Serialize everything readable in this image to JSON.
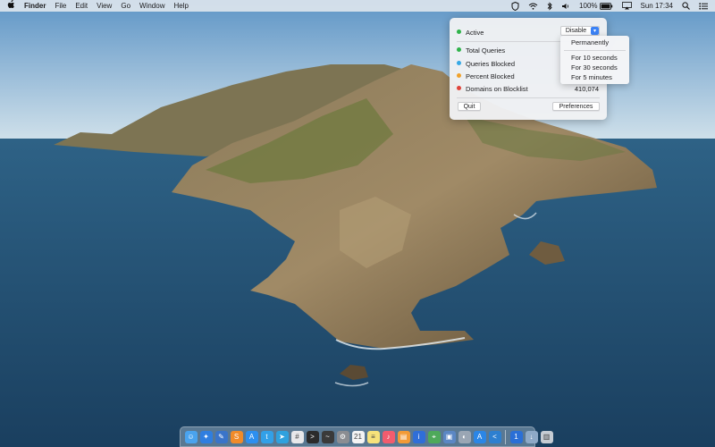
{
  "menubar": {
    "apple_icon": "apple-logo-icon",
    "app_name": "Finder",
    "menus": [
      "File",
      "Edit",
      "View",
      "Go",
      "Window",
      "Help"
    ],
    "status_icons": [
      "pihole-shield-icon",
      "wifi-icon",
      "bluetooth-icon",
      "volume-icon"
    ],
    "battery": "100%",
    "airplay_icon": "airplay-icon",
    "clock": "Sun 17:34",
    "search_icon": "spotlight-search-icon",
    "control_icon": "notification-center-icon"
  },
  "panel": {
    "status_label": "Active",
    "status_color": "#2fb34a",
    "disable_label": "Disable",
    "stats": [
      {
        "label": "Total Queries",
        "value": "",
        "color": "#2fb34a"
      },
      {
        "label": "Queries Blocked",
        "value": "",
        "color": "#37a9e6"
      },
      {
        "label": "Percent Blocked",
        "value": "",
        "color": "#f0a22c"
      },
      {
        "label": "Domains on Blocklist",
        "value": "410,074",
        "color": "#e0443b"
      }
    ],
    "quit_label": "Quit",
    "preferences_label": "Preferences"
  },
  "dropdown": {
    "items": [
      "Permanently",
      "For 10 seconds",
      "For 30 seconds",
      "For 5 minutes"
    ]
  },
  "dock": {
    "icons": [
      {
        "name": "finder-icon",
        "color": "#4aa3ee",
        "glyph": "☺"
      },
      {
        "name": "safari-icon",
        "color": "#2f7ee0",
        "glyph": "✦"
      },
      {
        "name": "xcode-icon",
        "color": "#3a74c9",
        "glyph": "✎"
      },
      {
        "name": "sublime-icon",
        "color": "#f08b2a",
        "glyph": "S"
      },
      {
        "name": "app-store-icon",
        "color": "#2d8ff0",
        "glyph": "A"
      },
      {
        "name": "twitter-icon",
        "color": "#32a0e8",
        "glyph": "t"
      },
      {
        "name": "telegram-icon",
        "color": "#2fa1de",
        "glyph": "➤"
      },
      {
        "name": "slack-icon",
        "color": "#e8e8ea",
        "glyph": "#"
      },
      {
        "name": "terminal-icon",
        "color": "#2b2b2b",
        "glyph": ">"
      },
      {
        "name": "activity-monitor-icon",
        "color": "#3a3a3a",
        "glyph": "~"
      },
      {
        "name": "system-preferences-icon",
        "color": "#8b8d92",
        "glyph": "⚙"
      },
      {
        "name": "calendar-icon",
        "color": "#f4f4f4",
        "glyph": "21"
      },
      {
        "name": "notes-icon",
        "color": "#f7e27a",
        "glyph": "≡"
      },
      {
        "name": "music-icon",
        "color": "#f25c6e",
        "glyph": "♪"
      },
      {
        "name": "books-icon",
        "color": "#f29a36",
        "glyph": "▤"
      },
      {
        "name": "password-icon",
        "color": "#2f6ed8",
        "glyph": "i"
      },
      {
        "name": "maps-icon",
        "color": "#4ea95a",
        "glyph": "⌖"
      },
      {
        "name": "preview-icon",
        "color": "#5b87c4",
        "glyph": "▣"
      },
      {
        "name": "photo-icon",
        "color": "#9aa6b4",
        "glyph": "◐"
      },
      {
        "name": "app-store-2-icon",
        "color": "#2b86e6",
        "glyph": "A"
      },
      {
        "name": "vscode-icon",
        "color": "#2d7fd0",
        "glyph": "<"
      }
    ],
    "right_icons": [
      {
        "name": "onepassword-icon",
        "color": "#2a6fd6",
        "glyph": "1"
      },
      {
        "name": "downloads-folder-icon",
        "color": "#8ea9c7",
        "glyph": "↓"
      },
      {
        "name": "trash-icon",
        "color": "#c6ccd3",
        "glyph": "▥"
      }
    ]
  }
}
